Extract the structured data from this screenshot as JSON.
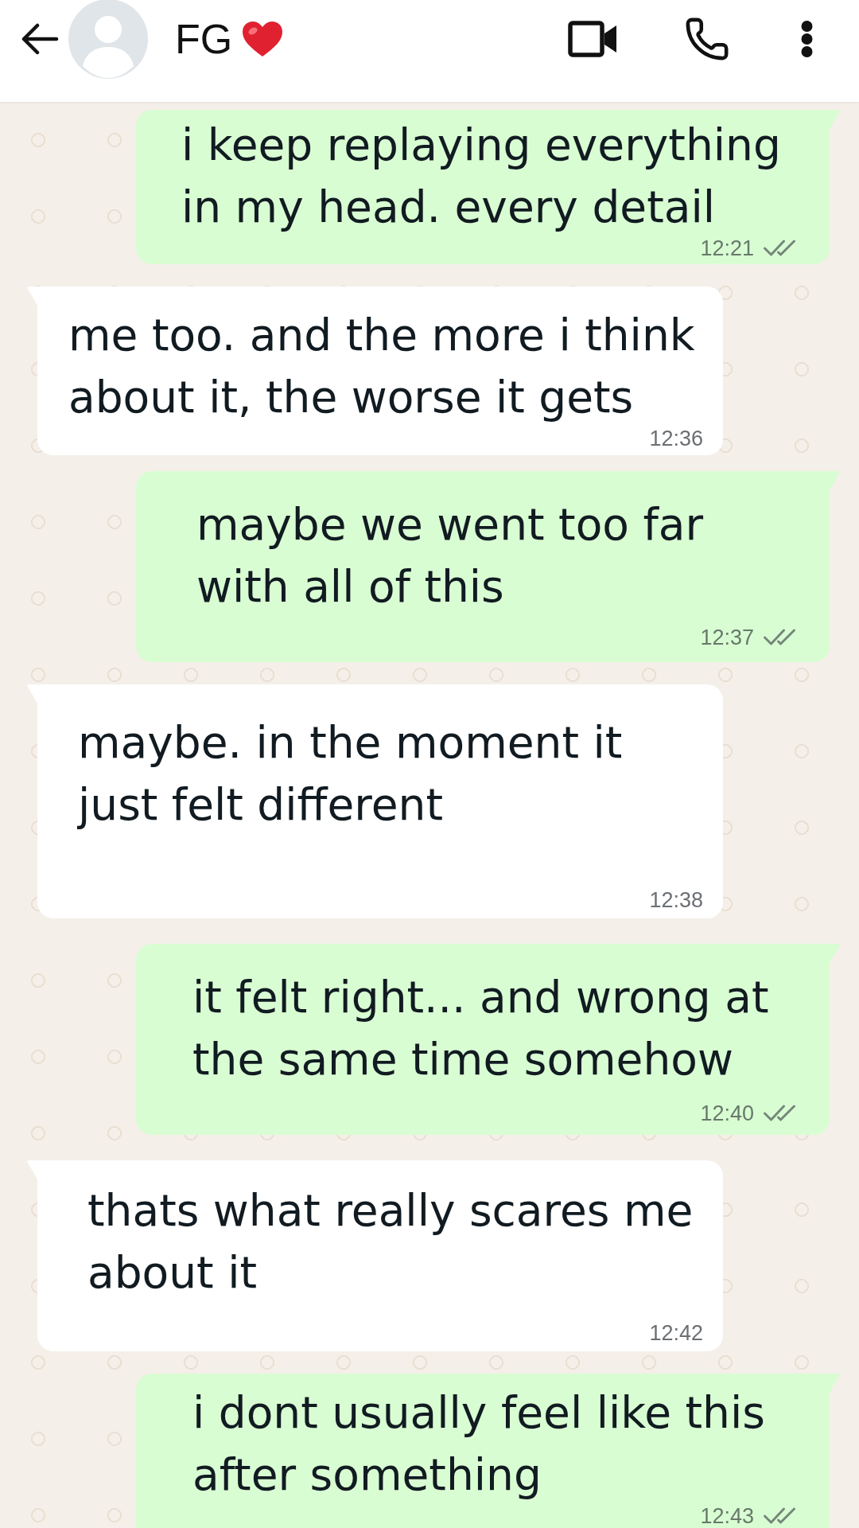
{
  "header": {
    "contact_name": "FG"
  },
  "messages": [
    {
      "kind": "outgoing",
      "text": "i keep replaying everything in my head. every detail",
      "time": "12:21",
      "read": false
    },
    {
      "kind": "incoming",
      "text": "me too. and the more i think about it, the worse it gets",
      "time": "12:36"
    },
    {
      "kind": "outgoing",
      "text": "maybe we went too far with all of this",
      "time": "12:37",
      "read": false
    },
    {
      "kind": "incoming",
      "text": "maybe. in the moment it just felt different",
      "time": "12:38"
    },
    {
      "kind": "outgoing",
      "text": "it felt right... and wrong at the same time somehow",
      "time": "12:40",
      "read": false
    },
    {
      "kind": "incoming",
      "text": "thats what really scares me about it",
      "time": "12:42"
    },
    {
      "kind": "outgoing",
      "text": "i dont usually feel like this after something",
      "time": "12:43",
      "read": false
    }
  ]
}
